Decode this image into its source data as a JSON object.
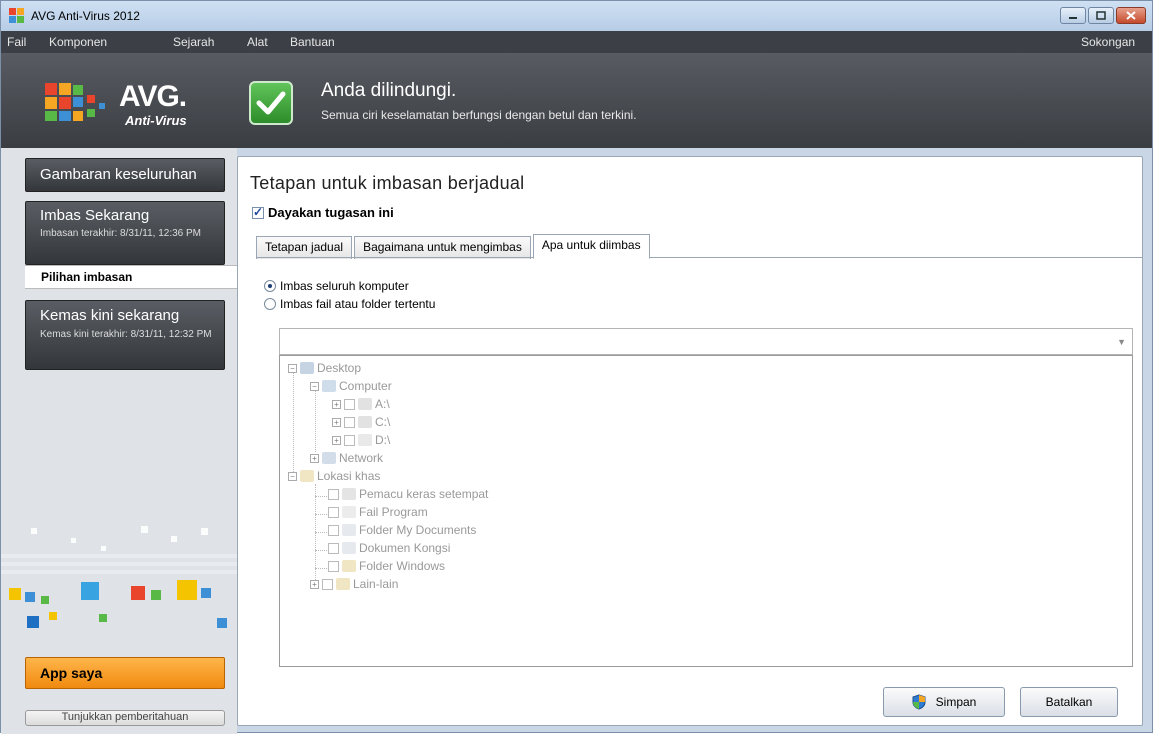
{
  "window": {
    "title": "AVG Anti-Virus 2012"
  },
  "menu": {
    "items": [
      "Fail",
      "Komponen",
      "Sejarah",
      "Alat",
      "Bantuan"
    ],
    "support": "Sokongan"
  },
  "header": {
    "logo_text": "AVG.",
    "logo_sub": "Anti-Virus",
    "status_title": "Anda dilindungi.",
    "status_sub": "Semua ciri keselamatan berfungsi dengan betul dan terkini."
  },
  "sidebar": {
    "overview": "Gambaran keseluruhan",
    "scan_now": "Imbas Sekarang",
    "scan_last": "Imbasan terakhir: 8/31/11, 12:36 PM",
    "scan_options": "Pilihan imbasan",
    "update_now": "Kemas kini sekarang",
    "update_last": "Kemas kini terakhir: 8/31/11, 12:32 PM",
    "my_apps": "App saya",
    "show_notification": "Tunjukkan pemberitahuan"
  },
  "panel": {
    "title": "Tetapan untuk imbasan berjadual",
    "enable_task": "Dayakan tugasan ini",
    "tabs": [
      "Tetapan jadual",
      "Bagaimana untuk mengimbas",
      "Apa untuk diimbas"
    ],
    "radio_whole": "Imbas seluruh komputer",
    "radio_specific": "Imbas fail atau folder tertentu",
    "tree": {
      "desktop": "Desktop",
      "computer": "Computer",
      "drive_a": "A:\\",
      "drive_c": "C:\\",
      "drive_d": "D:\\",
      "network": "Network",
      "special": "Lokasi khas",
      "local_hdd": "Pemacu keras setempat",
      "program_files": "Fail Program",
      "my_documents": "Folder My Documents",
      "shared_docs": "Dokumen Kongsi",
      "windows_folder": "Folder Windows",
      "others": "Lain-lain"
    },
    "save": "Simpan",
    "cancel": "Batalkan"
  }
}
